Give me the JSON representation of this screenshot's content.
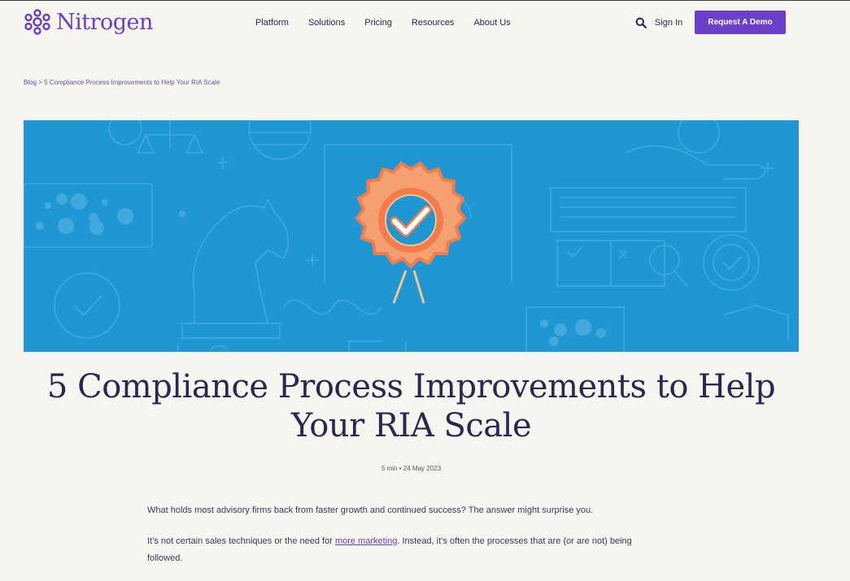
{
  "header": {
    "logo_text": "Nitrogen",
    "nav": [
      "Platform",
      "Solutions",
      "Pricing",
      "Resources",
      "About Us"
    ],
    "sign_in": "Sign In",
    "demo_button": "Request A Demo"
  },
  "breadcrumb": {
    "root": "Blog",
    "separator": ">",
    "current": "5 Compliance Process Improvements to Help Your RIA Scale"
  },
  "hero": {
    "icon": "award-badge-checkmark-icon",
    "colors": {
      "background": "#1f97d3",
      "badge": "#f47b4a",
      "check": "#ffffff"
    }
  },
  "article": {
    "title": "5 Compliance Process Improvements to Help Your RIA Scale",
    "read_time": "5 min",
    "meta_separator": "•",
    "date": "24 May 2023",
    "para1": "What holds most advisory firms back from faster growth and continued success? The answer might surprise you.",
    "para2_before": "It’s not certain sales techniques or the need for ",
    "para2_link": "more marketing",
    "para2_after": ". Instead, it’s often the processes that are (or are not) being followed."
  },
  "colors": {
    "brand": "#6a3fc9",
    "page_bg": "#f6f5ef",
    "text": "#2a2850"
  }
}
